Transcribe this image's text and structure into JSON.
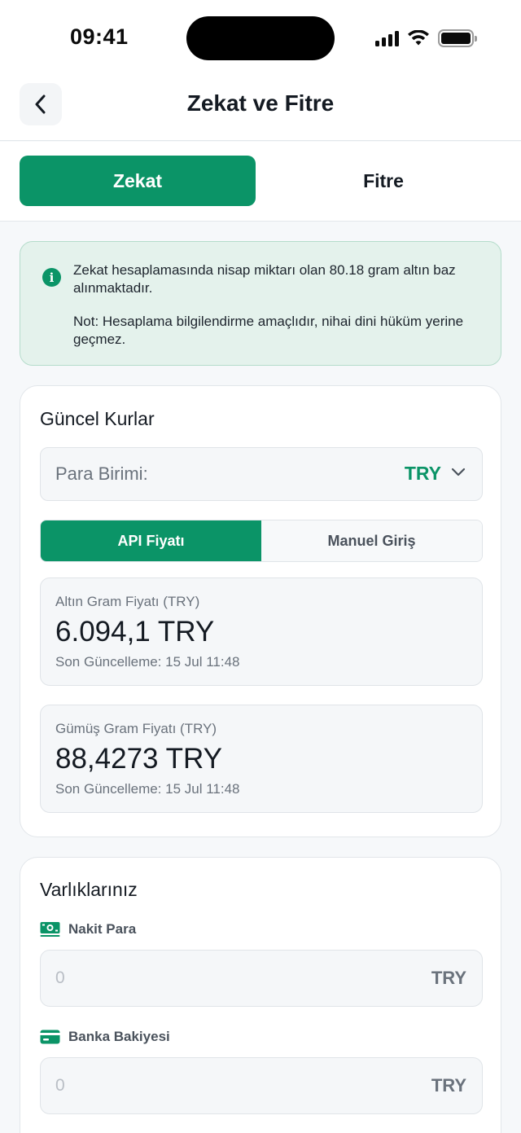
{
  "status_bar": {
    "time": "09:41"
  },
  "header": {
    "title": "Zekat ve Fitre",
    "back_icon": "chevron-left-icon"
  },
  "tabs": [
    {
      "label": "Zekat",
      "active": true
    },
    {
      "label": "Fitre",
      "active": false
    }
  ],
  "info": {
    "icon": "info-icon",
    "line1": "Zekat hesaplamasında nisap miktarı olan 80.18 gram altın baz alınmaktadır.",
    "line2": "Not: Hesaplama bilgilendirme amaçlıdır, nihai dini hüküm yerine geçmez."
  },
  "rates": {
    "title": "Güncel Kurlar",
    "currency_label": "Para Birimi:",
    "currency_value": "TRY",
    "segment": {
      "api_label": "API Fiyatı",
      "manual_label": "Manuel Giriş",
      "selected": "API Fiyatı"
    },
    "gold": {
      "label": "Altın Gram Fiyatı (TRY)",
      "value": "6.094,1 TRY",
      "updated": "Son Güncelleme: 15 Jul 11:48"
    },
    "silver": {
      "label": "Gümüş Gram Fiyatı (TRY)",
      "value": "88,4273 TRY",
      "updated": "Son Güncelleme: 15 Jul 11:48"
    }
  },
  "assets": {
    "title": "Varlıklarınız",
    "cash": {
      "label": "Nakit Para",
      "icon": "money-icon",
      "placeholder": "0",
      "unit": "TRY"
    },
    "bank": {
      "label": "Banka Bakiyesi",
      "icon": "credit-card-icon",
      "placeholder": "0",
      "unit": "TRY"
    }
  },
  "colors": {
    "accent": "#0b9467",
    "info_bg": "#e4f2ec",
    "background": "#f6f8fa"
  }
}
